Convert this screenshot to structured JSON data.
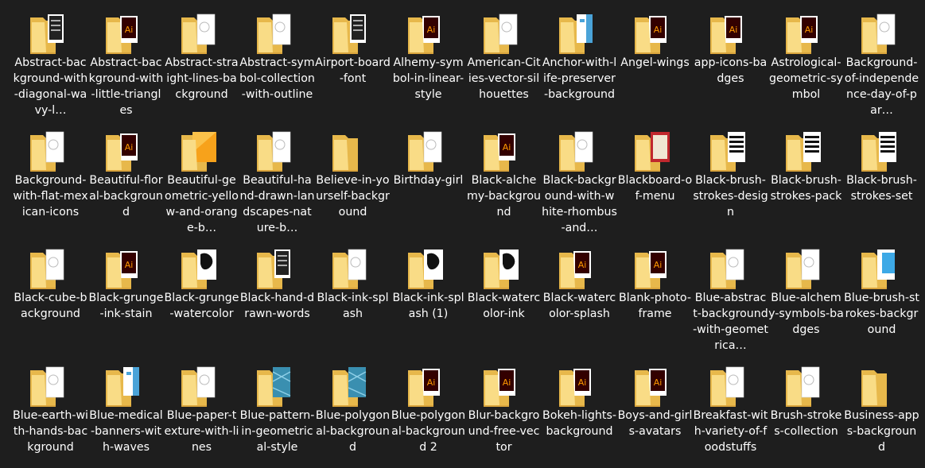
{
  "folders": [
    {
      "name": "Abstract-background-with-diagonal-wavy-lines",
      "display": "Abstract-background-with-diagonal-wavy-l…",
      "preview": "doc-dark"
    },
    {
      "name": "Abstract-background-with-little-triangles",
      "display": "Abstract-background-with-little-triangles",
      "preview": "ai"
    },
    {
      "name": "Abstract-straight-lines-background",
      "display": "Abstract-straight-lines-background",
      "preview": "doc-light"
    },
    {
      "name": "Abstract-symbol-collection-with-outline",
      "display": "Abstract-symbol-collection-with-outline",
      "preview": "doc-light"
    },
    {
      "name": "Airport-board-font",
      "display": "Airport-board-font",
      "preview": "doc-dark"
    },
    {
      "name": "Alhemy-symbol-in-linear-style",
      "display": "Alhemy-symbol-in-linear-style",
      "preview": "ai"
    },
    {
      "name": "American-Cities-vector-silhouettes",
      "display": "American-Cities-vector-silhouettes",
      "preview": "doc-light"
    },
    {
      "name": "Anchor-with-life-preserver-background",
      "display": "Anchor-with-life-preserver-background",
      "preview": "doc-blue"
    },
    {
      "name": "Angel-wings",
      "display": "Angel-wings",
      "preview": "ai"
    },
    {
      "name": "app-icons-badges",
      "display": "app-icons-badges",
      "preview": "ai"
    },
    {
      "name": "Astrological-geometric-symbol",
      "display": "Astrological-geometric-symbol",
      "preview": "ai"
    },
    {
      "name": "Background-of-independence-day-of-party",
      "display": "Background-of-independence-day-of-par…",
      "preview": "doc-light"
    },
    {
      "name": "Background-with-flat-mexican-icons",
      "display": "Background-with-flat-mexican-icons",
      "preview": "doc-light"
    },
    {
      "name": "Beautiful-floral-background",
      "display": "Beautiful-floral-background",
      "preview": "ai"
    },
    {
      "name": "Beautiful-geometric-yellow-and-orange-background",
      "display": "Beautiful-geometric-yellow-and-orange-b…",
      "preview": "doc-orange"
    },
    {
      "name": "Beautiful-hand-drawn-landscapes-nature-background",
      "display": "Beautiful-hand-drawn-landscapes-nature-b…",
      "preview": "doc-light"
    },
    {
      "name": "Believe-in-yourself-background",
      "display": "Believe-in-yourself-background",
      "preview": "plain"
    },
    {
      "name": "Birthday-girl",
      "display": "Birthday-girl",
      "preview": "doc-light"
    },
    {
      "name": "Black-alchemy-background",
      "display": "Black-alchemy-background",
      "preview": "ai"
    },
    {
      "name": "Black-background-with-white-rhombus-and",
      "display": "Black-background-with-white-rhombus-and…",
      "preview": "doc-light"
    },
    {
      "name": "Blackboard-of-menu",
      "display": "Blackboard-of-menu",
      "preview": "doc-red"
    },
    {
      "name": "Black-brush-strokes-design",
      "display": "Black-brush-strokes-design",
      "preview": "doc-stripes"
    },
    {
      "name": "Black-brush-strokes-pack",
      "display": "Black-brush-strokes-pack",
      "preview": "doc-stripes"
    },
    {
      "name": "Black-brush-strokes-set",
      "display": "Black-brush-strokes-set",
      "preview": "doc-stripes"
    },
    {
      "name": "Black-cube-background",
      "display": "Black-cube-background",
      "preview": "doc-light"
    },
    {
      "name": "Black-grunge-ink-stain",
      "display": "Black-grunge-ink-stain",
      "preview": "ai"
    },
    {
      "name": "Black-grunge-watercolor",
      "display": "Black-grunge-watercolor",
      "preview": "doc-ink"
    },
    {
      "name": "Black-hand-drawn-words",
      "display": "Black-hand-drawn-words",
      "preview": "doc-dark"
    },
    {
      "name": "Black-ink-splash",
      "display": "Black-ink-splash",
      "preview": "doc-light"
    },
    {
      "name": "Black-ink-splash (1)",
      "display": "Black-ink-splash (1)",
      "preview": "doc-ink"
    },
    {
      "name": "Black-watercolor-ink",
      "display": "Black-watercolor-ink",
      "preview": "doc-ink"
    },
    {
      "name": "Black-watercolor-splash",
      "display": "Black-watercolor-splash",
      "preview": "ai"
    },
    {
      "name": "Blank-photo-frame",
      "display": "Blank-photo-frame",
      "preview": "ai"
    },
    {
      "name": "Blue-abstract-background-with-geometrical",
      "display": "Blue-abstract-background-with-geometrica…",
      "preview": "doc-light"
    },
    {
      "name": "Blue-alchemy-symbols-badges",
      "display": "Blue-alchemy-symbols-badges",
      "preview": "doc-light"
    },
    {
      "name": "Blue-brush-strokes-background",
      "display": "Blue-brush-strokes-background",
      "preview": "doc-skyblue"
    },
    {
      "name": "Blue-earth-with-hands-background",
      "display": "Blue-earth-with-hands-background",
      "preview": "doc-light"
    },
    {
      "name": "Blue-medical-banners-with-waves",
      "display": "Blue-medical-banners-with-waves",
      "preview": "doc-blue"
    },
    {
      "name": "Blue-paper-texture-with-lines",
      "display": "Blue-paper-texture-with-lines",
      "preview": "doc-light"
    },
    {
      "name": "Blue-pattern-in-geometrical-style",
      "display": "Blue-pattern-in-geometrical-style",
      "preview": "doc-teal"
    },
    {
      "name": "Blue-polygonal-background",
      "display": "Blue-polygonal-background",
      "preview": "doc-teal"
    },
    {
      "name": "Blue-polygonal-background 2",
      "display": "Blue-polygonal-background 2",
      "preview": "ai"
    },
    {
      "name": "Blur-background-free-vector",
      "display": "Blur-background-free-vector",
      "preview": "ai"
    },
    {
      "name": "Bokeh-lights-background",
      "display": "Bokeh-lights-background",
      "preview": "ai"
    },
    {
      "name": "Boys-and-girls-avatars",
      "display": "Boys-and-girls-avatars",
      "preview": "ai"
    },
    {
      "name": "Breakfast-with-variety-of-foodstuffs",
      "display": "Breakfast-with-variety-of-foodstuffs",
      "preview": "doc-light"
    },
    {
      "name": "Brush-strokes-collection",
      "display": "Brush-strokes-collection",
      "preview": "doc-light"
    },
    {
      "name": "Business-apps-background",
      "display": "Business-apps-background",
      "preview": "plain"
    }
  ],
  "colors": {
    "background": "#1e1e1e",
    "folder_back": "#e7b84b",
    "folder_front": "#f9dc86",
    "ai_orange": "#ff9a00",
    "ai_dark": "#330000"
  }
}
